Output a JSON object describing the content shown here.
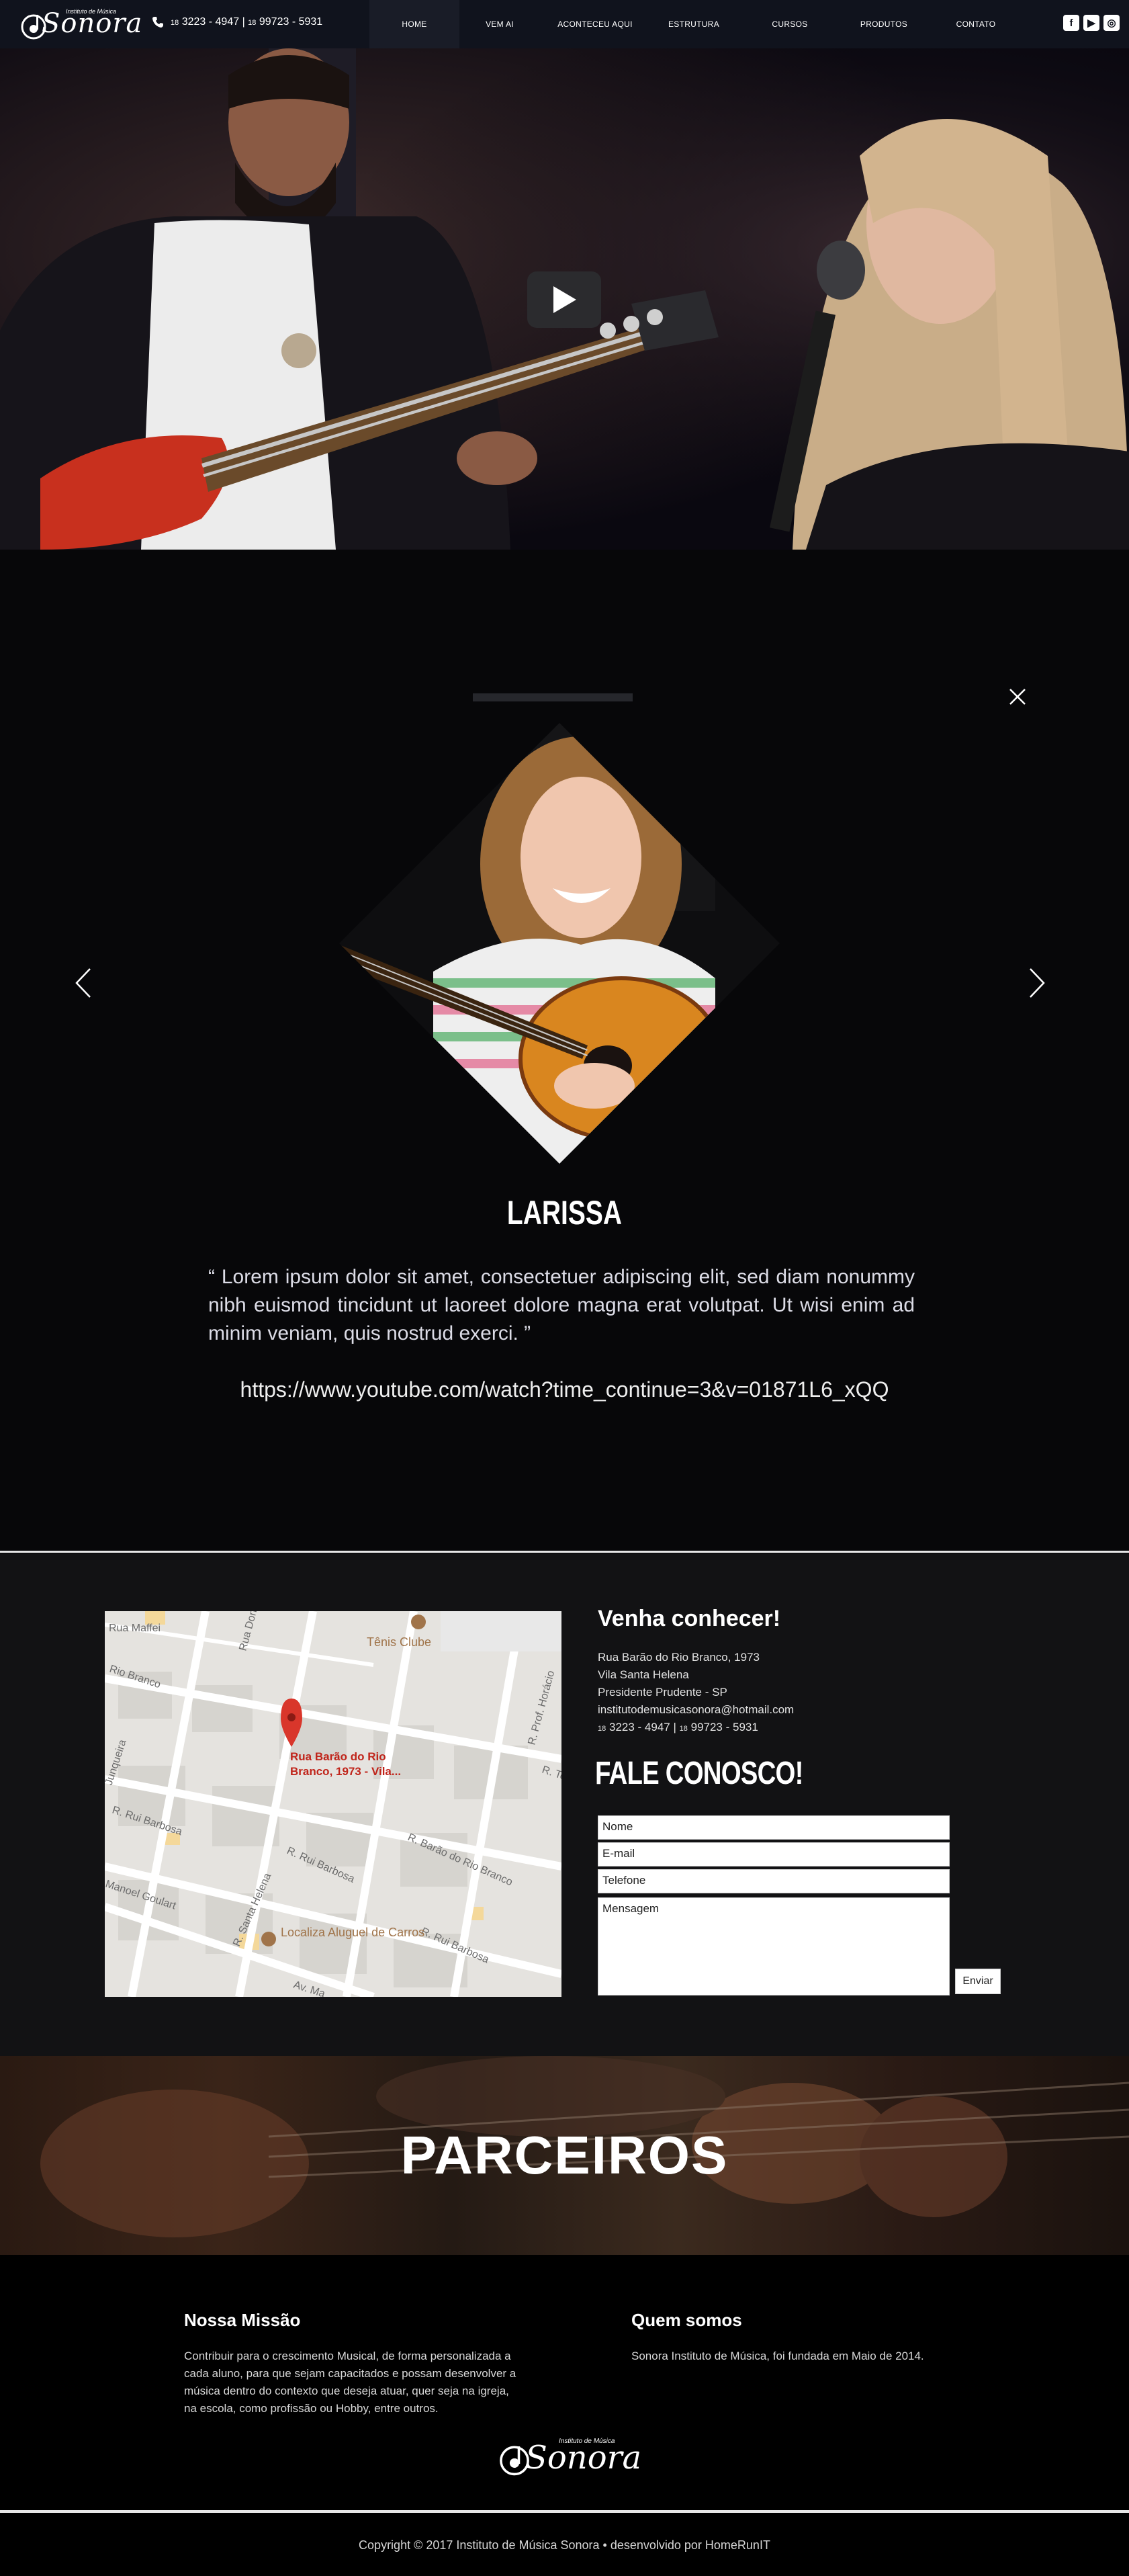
{
  "nav": {
    "logo_small": "Instituto de Música",
    "logo_script": "Sonora",
    "phone_prefix1": "18",
    "phone1": "3223 - 4947",
    "phone_sep": "|",
    "phone_prefix2": "18",
    "phone2": "99723 - 5931",
    "menu": [
      {
        "label": "HOME",
        "active": true
      },
      {
        "label": "VEM AI",
        "active": false
      },
      {
        "label": "ACONTECEU AQUI",
        "active": false
      },
      {
        "label": "ESTRUTURA",
        "active": false
      },
      {
        "label": "CURSOS",
        "active": false
      },
      {
        "label": "PRODUTOS",
        "active": false
      },
      {
        "label": "CONTATO",
        "active": false
      }
    ],
    "social": [
      "facebook-icon",
      "youtube-icon",
      "instagram-icon"
    ]
  },
  "testimonial": {
    "name": "LARISSA",
    "quote": "“ Lorem ipsum dolor sit amet, consectetuer adipiscing elit, sed diam nonummy nibh euismod tincidunt ut laoreet dolore magna  erat volutpat. Ut wisi enim ad minim veniam, quis nostrud exerci. ”",
    "link": "https://www.youtube.com/watch?time_continue=3&v=01871L6_xQQ"
  },
  "contact": {
    "title": "Venha conhecer!",
    "address_line1": "Rua Barão do Rio Branco, 1973",
    "address_line2": "Vila Santa Helena",
    "address_line3": "Presidente Prudente - SP",
    "email": "institutodemusicasonora@hotmail.com",
    "phone_prefix1": "18",
    "phone1": "3223 - 4947",
    "phone_sep": "|",
    "phone_prefix2": "18",
    "phone2": "99723 - 5931",
    "form_title": "FALE CONOSCO!",
    "fields": {
      "nome": "Nome",
      "email": "E-mail",
      "telefone": "Telefone",
      "mensagem": "Mensagem"
    },
    "send": "Enviar",
    "map": {
      "pin_label": "Rua Barão do Rio Branco, 1973 -  Vila...",
      "streets": [
        "Tênis Clube",
        "Rua Maffei",
        "Rua Dona Militão",
        "Rio Branco",
        "R. Prof. Horácio",
        "R. Te",
        "Junqueira",
        "R. Rui Barbosa",
        "R. Barão do Rio Branco",
        "R. Rui Barbosa",
        "R. Santa Helena",
        "Manoel Goulart",
        "Localiza Aluguel de Carros",
        "R. Rui Barbosa",
        "Av. Ma"
      ]
    }
  },
  "partners": {
    "title": "PARCEIROS"
  },
  "footer": {
    "mission_title": "Nossa Missão",
    "mission_text": "Contribuir para o crescimento Musical, de forma personalizada a cada aluno, para que sejam capacitados e possam desenvolver a música dentro do contexto que deseja atuar, quer seja na igreja, na escola, como profissão ou Hobby, entre outros.",
    "about_title": "Quem somos",
    "about_text": "Sonora Instituto de Música, foi fundada em Maio de 2014.",
    "logo_small": "Instituto de Música",
    "logo_script": "Sonora",
    "copyright": "Copyright © 2017 Instituto de Música Sonora  •  desenvolvido por HomeRunIT"
  },
  "colors": {
    "nav_bg": "#10131d",
    "page_bg": "#070709",
    "contact_bg": "#121214",
    "map_pin": "#d9362b",
    "guitar_orange": "#d9861f"
  }
}
